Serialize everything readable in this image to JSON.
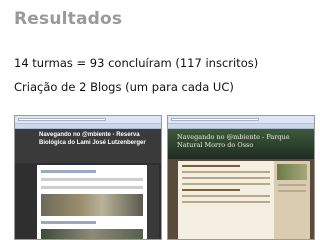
{
  "slide": {
    "title": "Resultados",
    "line1": "14 turmas = 93 concluíram (117 inscritos)",
    "line2": "Criação de 2 Blogs (um para cada UC)"
  },
  "blog_left": {
    "title": "Navegando no @mbiente - Reserva Biológica do Lami José Lutzenberger"
  },
  "blog_right": {
    "title": "Navegando no @mbiente - Parque Natural Morro do Osso"
  }
}
